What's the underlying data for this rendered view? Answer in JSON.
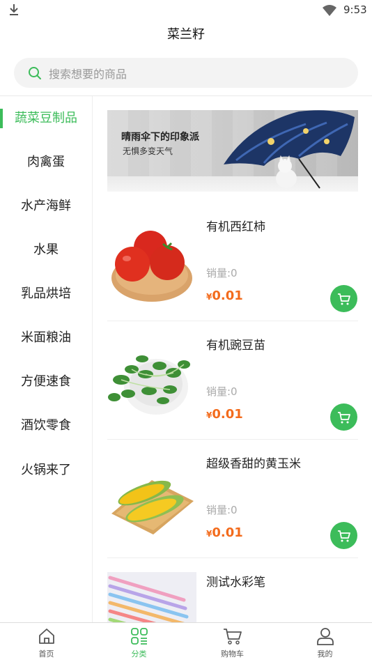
{
  "status_bar": {
    "time": "9:53"
  },
  "header": {
    "title": "菜兰籽"
  },
  "search": {
    "placeholder": "搜索想要的商品"
  },
  "sidebar": {
    "items": [
      {
        "label": "蔬菜豆制品",
        "active": true
      },
      {
        "label": "肉禽蛋",
        "active": false
      },
      {
        "label": "水产海鲜",
        "active": false
      },
      {
        "label": "水果",
        "active": false
      },
      {
        "label": "乳品烘培",
        "active": false
      },
      {
        "label": "米面粮油",
        "active": false
      },
      {
        "label": "方便速食",
        "active": false
      },
      {
        "label": "酒饮零食",
        "active": false
      },
      {
        "label": "火锅来了",
        "active": false
      }
    ]
  },
  "banner": {
    "headline": "晴雨伞下的印象派",
    "subline": "无惧多变天气"
  },
  "products": [
    {
      "name": "有机西红柿",
      "sales": "销量:0",
      "currency": "¥",
      "price": "0.01",
      "image": "tomato"
    },
    {
      "name": "有机豌豆苗",
      "sales": "销量:0",
      "currency": "¥",
      "price": "0.01",
      "image": "pea-sprouts"
    },
    {
      "name": "超级香甜的黄玉米",
      "sales": "销量:0",
      "currency": "¥",
      "price": "0.01",
      "image": "corn"
    },
    {
      "name": "测试水彩笔",
      "currency": "¥",
      "image": "watercolor-pens"
    }
  ],
  "tabbar": {
    "items": [
      {
        "label": "首页",
        "icon": "home-icon",
        "active": false
      },
      {
        "label": "分类",
        "icon": "category-icon",
        "active": true
      },
      {
        "label": "购物车",
        "icon": "cart-icon",
        "active": false
      },
      {
        "label": "我的",
        "icon": "user-icon",
        "active": false
      }
    ]
  },
  "colors": {
    "accent": "#3cbc5a",
    "price": "#f36b1c",
    "muted": "#999999"
  }
}
